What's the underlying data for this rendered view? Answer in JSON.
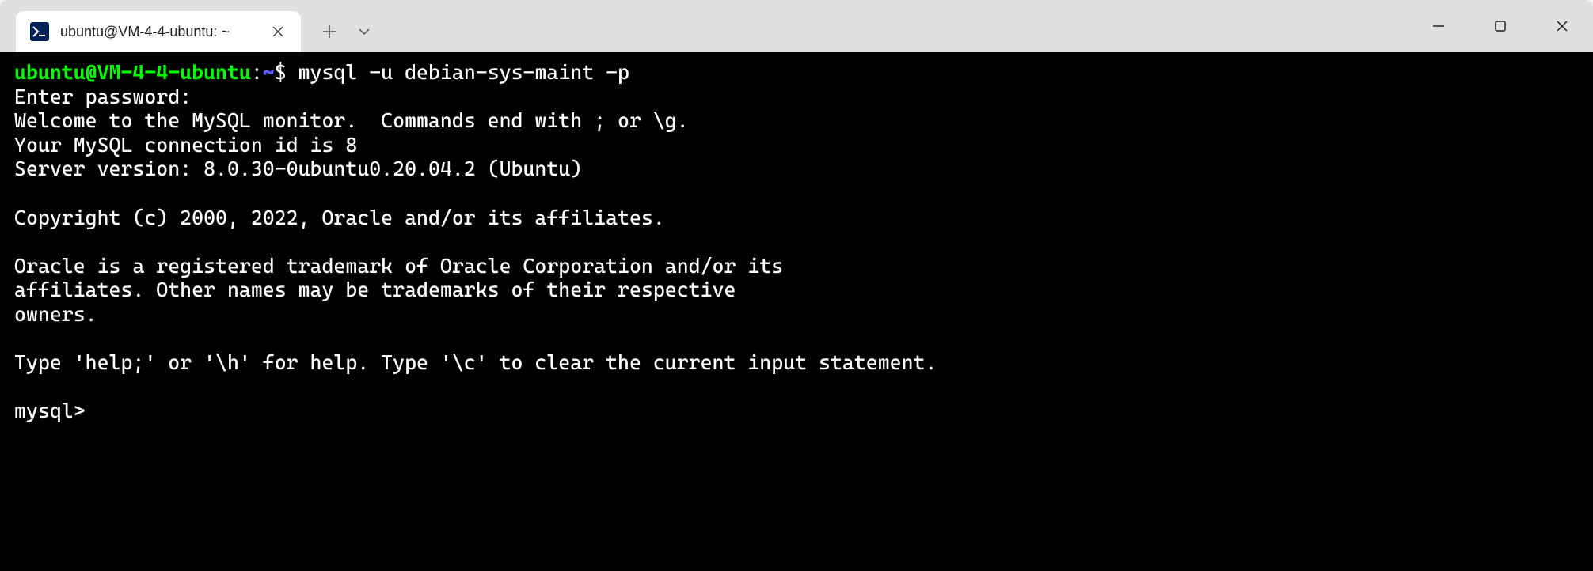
{
  "tab": {
    "title": "ubuntu@VM-4-4-ubuntu: ~",
    "icon_glyph": ">_"
  },
  "prompt": {
    "user_host": "ubuntu@VM-4-4-ubuntu",
    "path": "~",
    "symbol": "$"
  },
  "command": "mysql -u debian-sys-maint -p",
  "output": {
    "line1": "Enter password:",
    "line2": "Welcome to the MySQL monitor.  Commands end with ; or \\g.",
    "line3": "Your MySQL connection id is 8",
    "line4": "Server version: 8.0.30-0ubuntu0.20.04.2 (Ubuntu)",
    "line5": "",
    "line6": "Copyright (c) 2000, 2022, Oracle and/or its affiliates.",
    "line7": "",
    "line8": "Oracle is a registered trademark of Oracle Corporation and/or its",
    "line9": "affiliates. Other names may be trademarks of their respective",
    "line10": "owners.",
    "line11": "",
    "line12": "Type 'help;' or '\\h' for help. Type '\\c' to clear the current input statement.",
    "line13": "",
    "line14": "mysql>"
  }
}
